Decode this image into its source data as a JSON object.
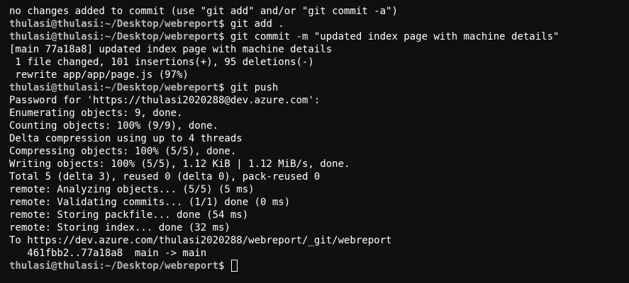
{
  "terminal": {
    "line_0": "no changes added to commit (use \"git add\" and/or \"git commit -a\")",
    "prompt_user": "thulasi@thulasi",
    "prompt_path": ":~/Desktop/webreport",
    "prompt_symbol": "$ ",
    "cmd_1": "git add .",
    "cmd_2": "git commit -m \"updated index page with machine details\"",
    "line_3": "[main 77a18a8] updated index page with machine details",
    "line_4": " 1 file changed, 101 insertions(+), 95 deletions(-)",
    "line_5": " rewrite app/app/page.js (97%)",
    "cmd_6": "git push",
    "line_7": "Password for 'https://thulasi2020288@dev.azure.com':",
    "line_8": "Enumerating objects: 9, done.",
    "line_9": "Counting objects: 100% (9/9), done.",
    "line_10": "Delta compression using up to 4 threads",
    "line_11": "Compressing objects: 100% (5/5), done.",
    "line_12": "Writing objects: 100% (5/5), 1.12 KiB | 1.12 MiB/s, done.",
    "line_13": "Total 5 (delta 3), reused 0 (delta 0), pack-reused 0",
    "line_14": "remote: Analyzing objects... (5/5) (5 ms)",
    "line_15": "remote: Validating commits... (1/1) done (0 ms)",
    "line_16": "remote: Storing packfile... done (54 ms)",
    "line_17": "remote: Storing index... done (32 ms)",
    "line_18": "To https://dev.azure.com/thulasi2020288/webreport/_git/webreport",
    "line_19": "   461fbb2..77a18a8  main -> main",
    "colors": {
      "background": "#101010",
      "text": "#ffffff",
      "prompt": "#b5b5b5"
    }
  }
}
